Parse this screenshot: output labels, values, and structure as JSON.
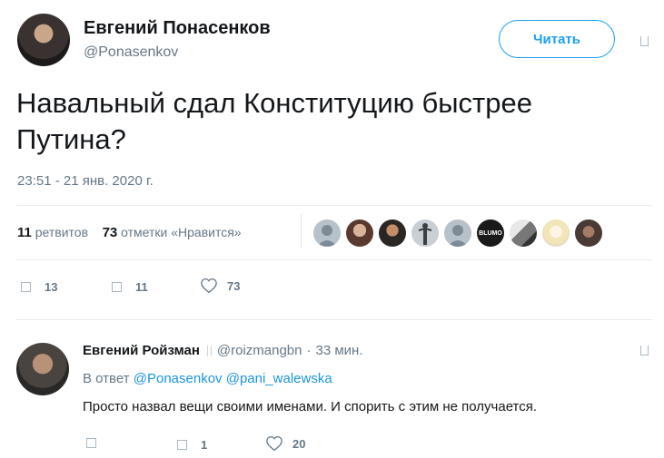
{
  "tweet": {
    "author_name": "Евгений Понасенков",
    "author_handle": "@Ponasenkov",
    "follow_label": "Читать",
    "text": "Навальный сдал Конституцию быстрее Путина?",
    "timestamp": "23:51 - 21 янв. 2020 г.",
    "retweets_count": "11",
    "retweets_label": "ретвитов",
    "likes_count": "73",
    "likes_label": "отметки «Нравится»",
    "liker_badge_text": "BLUMO",
    "actions": {
      "replies": "13",
      "retweets": "11",
      "likes": "73"
    }
  },
  "reply": {
    "author_name": "Евгений Ройзман",
    "author_handle": "@roizmangbn",
    "separator": "·",
    "time": "33 мин.",
    "in_reply_prefix": "В ответ",
    "mentions": [
      "@Ponasenkov",
      "@pani_walewska"
    ],
    "text": "Просто назвал вещи своими именами. И спорить с этим не получается.",
    "actions": {
      "replies": "",
      "retweets": "1",
      "likes": "20"
    }
  },
  "colors": {
    "accent": "#1da1f2",
    "link": "#1b95e0",
    "text_primary": "#14171a",
    "text_secondary": "#657786",
    "divider": "#e6ecf0"
  }
}
